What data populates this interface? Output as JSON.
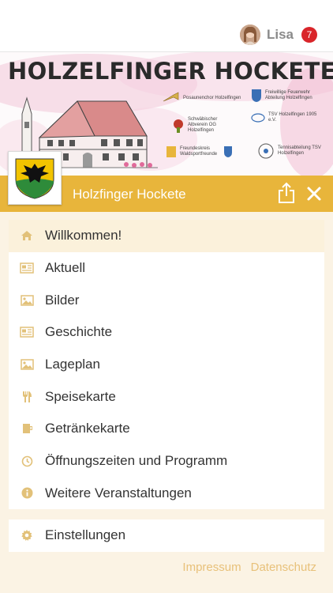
{
  "user": {
    "name": "Lisa",
    "notification_count": "7"
  },
  "banner": {
    "title": "HOLZELFINGER HOCKETE",
    "sponsors": [
      {
        "label": "Posaunenchor Holzelfingen"
      },
      {
        "label": "Freiwillige Feuerwehr Abteilung Holzelfingen"
      },
      {
        "label": "Schwäbischer Albverein OG Holzelfingen"
      },
      {
        "label": "TSV Holzelfingen 1905 e.V."
      },
      {
        "label": "Freundeskreis Waldsportfreunde"
      },
      {
        "label": "Tennisabteilung TSV Holzelfingen"
      }
    ]
  },
  "header": {
    "title": "Holzfinger Hockete"
  },
  "menu": {
    "items": [
      {
        "label": "Willkommen!",
        "icon": "home-icon"
      },
      {
        "label": "Aktuell",
        "icon": "newspaper-icon"
      },
      {
        "label": "Bilder",
        "icon": "image-icon"
      },
      {
        "label": "Geschichte",
        "icon": "newspaper-icon"
      },
      {
        "label": "Lageplan",
        "icon": "image-icon"
      },
      {
        "label": "Speisekarte",
        "icon": "cutlery-icon"
      },
      {
        "label": "Getränkekarte",
        "icon": "drink-icon"
      },
      {
        "label": "Öffnungszeiten und Programm",
        "icon": "clock-icon"
      },
      {
        "label": "Weitere Veranstaltungen",
        "icon": "info-icon"
      }
    ],
    "settings_label": "Einstellungen"
  },
  "footer": {
    "impressum": "Impressum",
    "datenschutz": "Datenschutz"
  },
  "colors": {
    "accent": "#e8b53b",
    "icon": "#e2c179",
    "active_bg": "#fbf1db",
    "badge": "#d9252a",
    "page_bg": "#fbf3e4"
  }
}
